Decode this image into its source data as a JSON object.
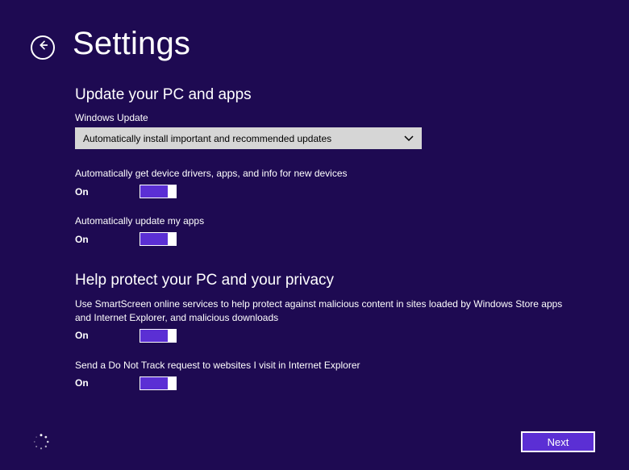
{
  "header": {
    "title": "Settings"
  },
  "updateSection": {
    "heading": "Update your PC and apps",
    "windowsUpdateLabel": "Windows Update",
    "windowsUpdateSelected": "Automatically install important and recommended updates",
    "toggles": [
      {
        "desc": "Automatically get device drivers, apps, and info for new devices",
        "state": "On"
      },
      {
        "desc": "Automatically update my apps",
        "state": "On"
      }
    ]
  },
  "privacySection": {
    "heading": "Help protect your PC and your privacy",
    "toggles": [
      {
        "desc": "Use SmartScreen online services to help protect against malicious content in sites loaded by Windows Store apps and Internet Explorer, and malicious downloads",
        "state": "On"
      },
      {
        "desc": "Send a Do Not Track request to websites I visit in Internet Explorer",
        "state": "On"
      }
    ]
  },
  "footer": {
    "nextLabel": "Next"
  },
  "colors": {
    "background": "#1e0a52",
    "accent": "#5b2fd4",
    "dropdownBg": "#d6d6d6"
  }
}
